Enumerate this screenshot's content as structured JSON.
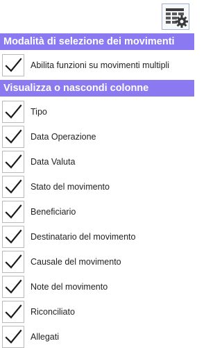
{
  "toolbar": {
    "grid_settings_icon": "grid-settings-icon"
  },
  "sections": {
    "selection": {
      "title": "Modalità di selezione dei movimenti",
      "items": [
        {
          "label": "Abilita funzioni su movimenti multipli",
          "checked": true
        }
      ]
    },
    "columns": {
      "title": "Visualizza o nascondi colonne",
      "items": [
        {
          "label": "Tipo",
          "checked": true
        },
        {
          "label": "Data Operazione",
          "checked": true
        },
        {
          "label": "Data Valuta",
          "checked": true
        },
        {
          "label": "Stato del movimento",
          "checked": true
        },
        {
          "label": "Beneficiario",
          "checked": true
        },
        {
          "label": "Destinatario del movimento",
          "checked": true
        },
        {
          "label": "Causale del movimento",
          "checked": true
        },
        {
          "label": "Note del movimento",
          "checked": true
        },
        {
          "label": "Riconciliato",
          "checked": true
        },
        {
          "label": "Allegati",
          "checked": true
        }
      ]
    }
  },
  "colors": {
    "header_bg": "#8a79f0",
    "header_text": "#ffffff",
    "checkmark": "#1a1a1a"
  }
}
